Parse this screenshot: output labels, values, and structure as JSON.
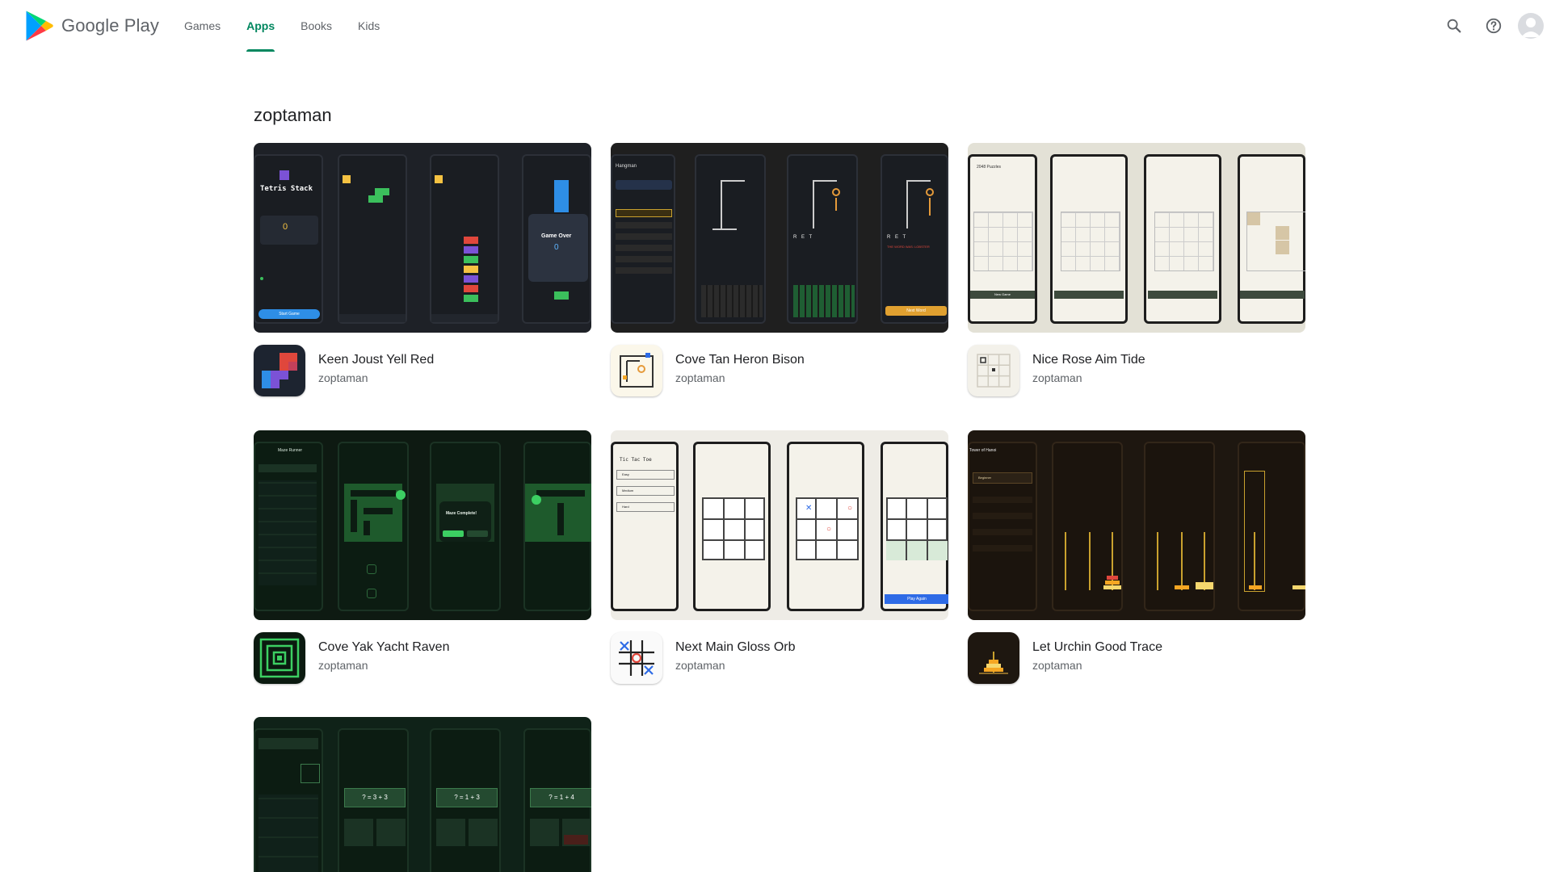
{
  "header": {
    "brand": "Google Play",
    "nav": [
      {
        "label": "Games",
        "active": false
      },
      {
        "label": "Apps",
        "active": true
      },
      {
        "label": "Books",
        "active": false
      },
      {
        "label": "Kids",
        "active": false
      }
    ],
    "icons": [
      "search-icon",
      "help-icon",
      "account-avatar"
    ]
  },
  "developer": "zoptaman",
  "apps": [
    {
      "name": "Keen Joust Yell Red",
      "developer": "zoptaman"
    },
    {
      "name": "Cove Tan Heron Bison",
      "developer": "zoptaman"
    },
    {
      "name": "Nice Rose Aim Tide",
      "developer": "zoptaman"
    },
    {
      "name": "Cove Yak Yacht Raven",
      "developer": "zoptaman"
    },
    {
      "name": "Next Main Gloss Orb",
      "developer": "zoptaman"
    },
    {
      "name": "Let Urchin Good Trace",
      "developer": "zoptaman"
    },
    {
      "name": "",
      "developer": ""
    }
  ],
  "screenshot_text": {
    "tetris": {
      "title": "Tetris Stack",
      "score": "0",
      "start": "Start Game",
      "over": "Game Over",
      "over_score": "0"
    },
    "hangman": {
      "title": "Hangman",
      "word1": "R E T",
      "word2": "R E T",
      "lost": "THE WORD WAS: LOBSTER",
      "next": "Next Word"
    },
    "game2048": {
      "title": "2048 Puzzles",
      "new": "New Game"
    },
    "maze": {
      "title": "Maze Runner",
      "complete": "Maze Complete!"
    },
    "ttt": {
      "title": "Tic Tac Toe",
      "easy": "Easy",
      "medium": "Medium",
      "hard": "Hard",
      "again": "Play Again"
    },
    "hanoi": {
      "title": "Tower of Hanoi",
      "level": "Beginner"
    },
    "math": {
      "q1": "? = 3 + 3",
      "q2": "? = 1 + 3",
      "q3": "? = 1 + 4"
    }
  },
  "colors": {
    "brand_green": "#01875f",
    "text_primary": "#202124",
    "text_secondary": "#5f6368"
  }
}
